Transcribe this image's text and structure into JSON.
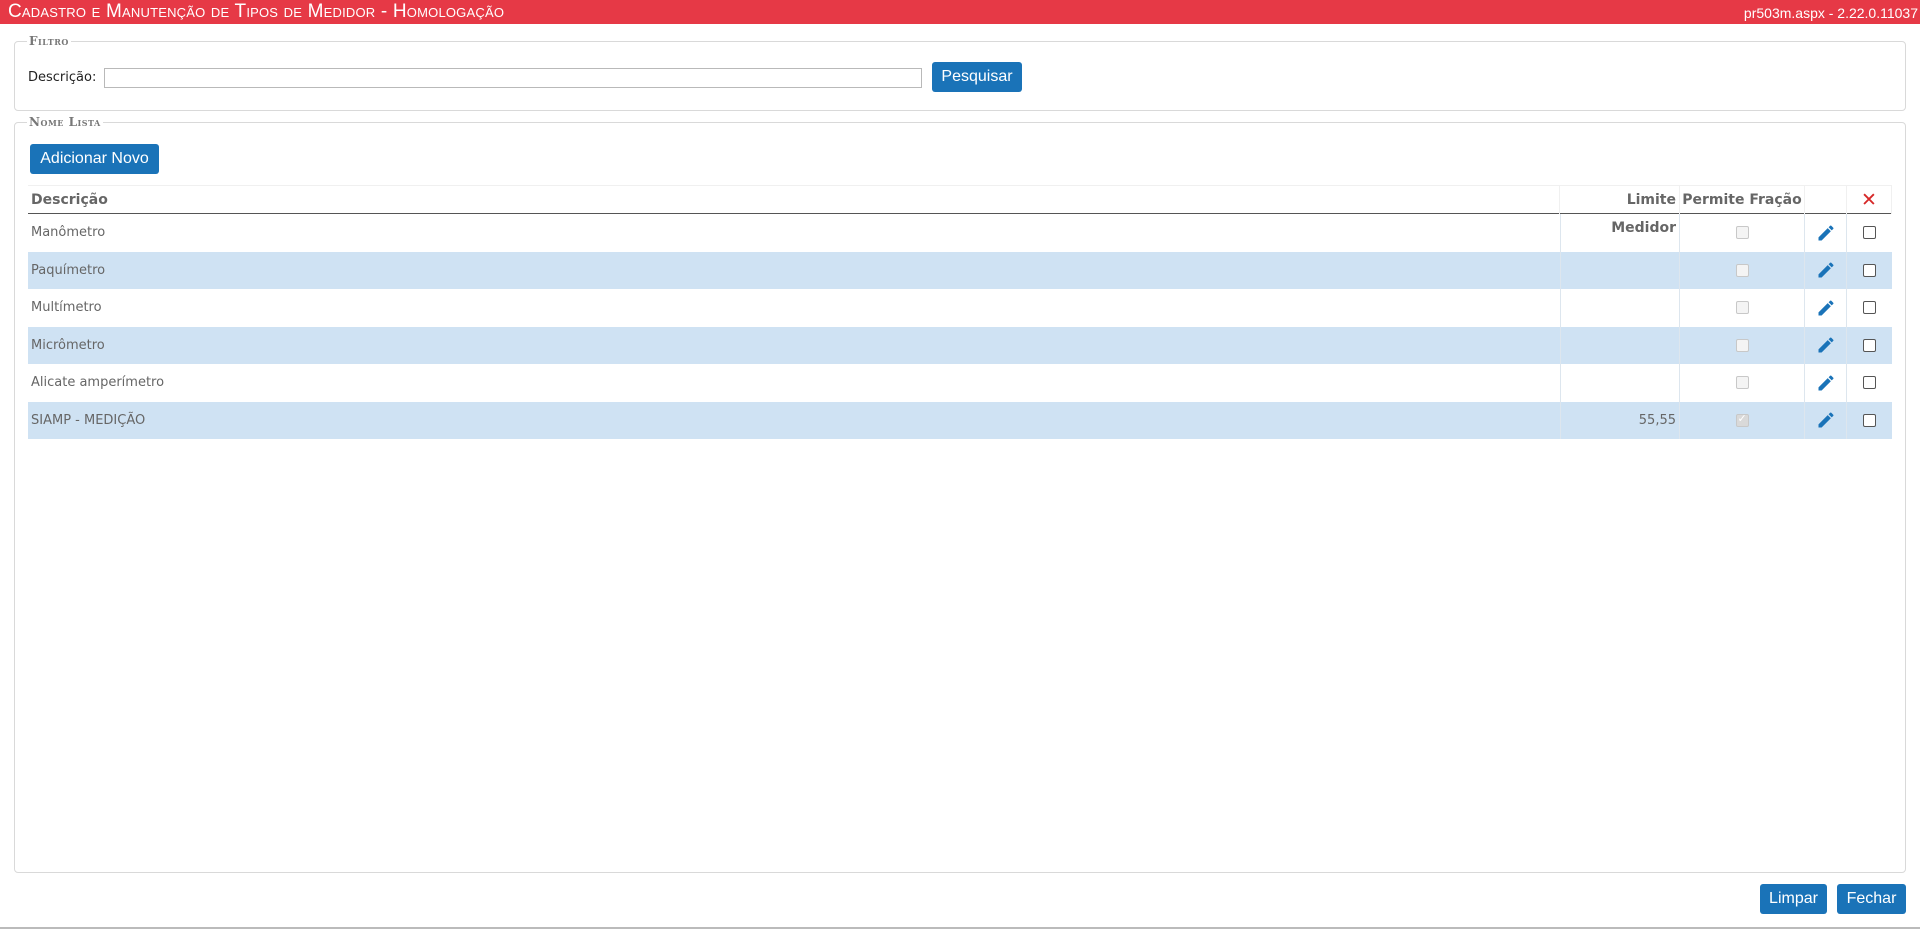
{
  "header": {
    "title": "Cadastro e Manutenção de Tipos de Medidor  - Homologação",
    "version": "pr503m.aspx - 2.22.0.11037"
  },
  "filter": {
    "legend": "Filtro",
    "description_label": "Descrição:",
    "description_value": "",
    "search_button": "Pesquisar"
  },
  "list": {
    "legend": "Nome Lista",
    "add_button": "Adicionar Novo",
    "columns": {
      "description": "Descrição",
      "limit": "Limite Medidor",
      "fraction": "Permite Fração",
      "delete_icon": "✕"
    },
    "rows": [
      {
        "description": "Manômetro",
        "limit": "",
        "fraction": false
      },
      {
        "description": "Paquímetro",
        "limit": "",
        "fraction": false
      },
      {
        "description": "Multímetro",
        "limit": "",
        "fraction": false
      },
      {
        "description": "Micrômetro",
        "limit": "",
        "fraction": false
      },
      {
        "description": "Alicate amperímetro",
        "limit": "",
        "fraction": false
      },
      {
        "description": "SIAMP - MEDIÇÃO",
        "limit": "55,55",
        "fraction": true
      }
    ]
  },
  "footer": {
    "clear_button": "Limpar",
    "close_button": "Fechar"
  },
  "icons": {
    "edit": "pencil-icon",
    "delete": "close-icon"
  },
  "colors": {
    "header": "#e63946",
    "button": "#1a73b8",
    "row_alt": "#cfe2f3",
    "delete_icon": "#d62828"
  }
}
